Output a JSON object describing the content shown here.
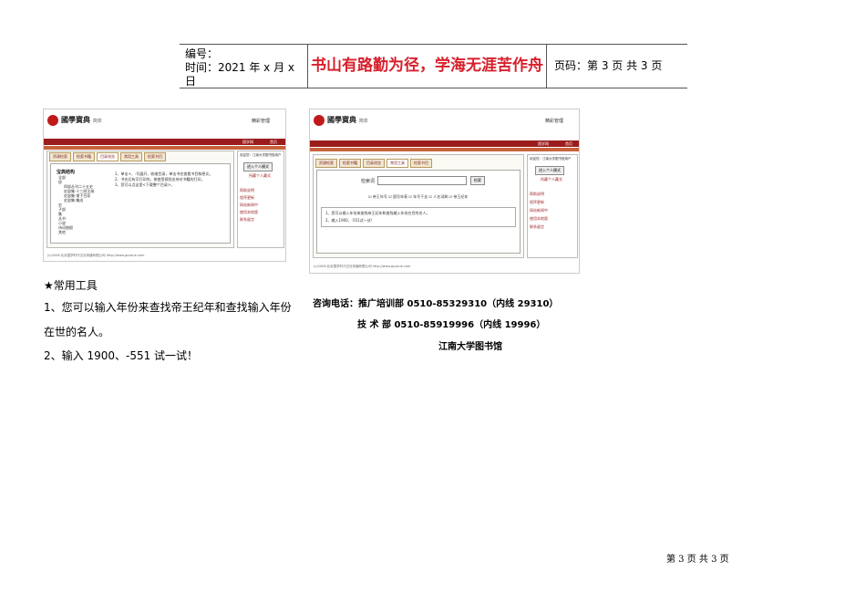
{
  "header": {
    "number_label": "编号：",
    "time_label": "时间：2021 年 x 月 x 日",
    "motto": "书山有路勤为径，学海无涯苦作舟",
    "page_label": "页码：第 3 页  共 3 页"
  },
  "screenshot1": {
    "brand": "國學寶典",
    "brand_sub": "简体",
    "header_right": "精彩管理",
    "top_links": [
      "国学网",
      "首页"
    ],
    "tabs": [
      "资源检索",
      "检索书籍",
      "目录浏览",
      "常用工具",
      "检索书目"
    ],
    "active_tab": 2,
    "tree_title": "宝典结构",
    "tree_items": [
      "全部",
      "经",
      "四部丛刊二十五史",
      "史部集·十三经注疏",
      "史部集·诸子百家",
      "史部集·集成",
      "史",
      "子部",
      "集",
      "丛书",
      "小说",
      "诗词曲赋",
      "其他"
    ],
    "info_lines": [
      "1、单击+、-号展开、收缩目录，单击书名查看书目和原文。",
      "2、书名后有可打印的，按使用规则支持对书籍的打印。",
      "3、您可以点这里<下载整个目录>。"
    ],
    "side_title": "欢迎您：江南大学图书馆用户",
    "side_button": "进入个人模式",
    "side_link": "所藏个人藏式",
    "side_links": [
      "帮助说明",
      "程序更新",
      "网站新闻中",
      "使用本地版",
      "联系留言"
    ],
    "footer": "(c)2008 北京国学时代文化传播有限公司 http://www.guoxue.com"
  },
  "screenshot2": {
    "brand": "國學寶典",
    "brand_sub": "简体",
    "header_right": "精彩管理",
    "top_links": [
      "国学网",
      "首页"
    ],
    "tabs": [
      "资源检索",
      "检索书籍",
      "目录浏览",
      "常用工具",
      "检索书目"
    ],
    "active_tab": 3,
    "search_label": "检索词",
    "search_button": "检索",
    "options": "☑ 帝王年号  ☑ 国号年表  ☑ 年号干支  ☑ 人名词典  ☑ 帝王纪年",
    "info_lines": [
      "1、您可以输入年份来查找帝王纪年和查找输入年份在世的名人。",
      "2、输入1900、-551试一试！"
    ],
    "side_title": "欢迎您：江南大学图书馆用户",
    "side_button": "进入个人模式",
    "side_link": "所藏个人藏式",
    "side_links": [
      "帮助说明",
      "程序更新",
      "网站新闻中",
      "使用本地版",
      "联系留言"
    ],
    "footer": "(c)2008 北京国学时代文化传播有限公司 http://www.guoxue.com"
  },
  "body_text": {
    "title": "★常用工具",
    "line1": "1、您可以输入年份来查找帝王纪年和查找输入年份",
    "line2": "在世的名人。",
    "line3": "2、输入 1900、-551 试一试！"
  },
  "contact": {
    "line1": "咨询电话：推广培训部 0510-85329310（内线 29310）",
    "line2": "技    术    部 0510-85919996（内线 19996）",
    "line3": "江南大学图书馆"
  },
  "page_number": "第 3 页  共 3 页"
}
